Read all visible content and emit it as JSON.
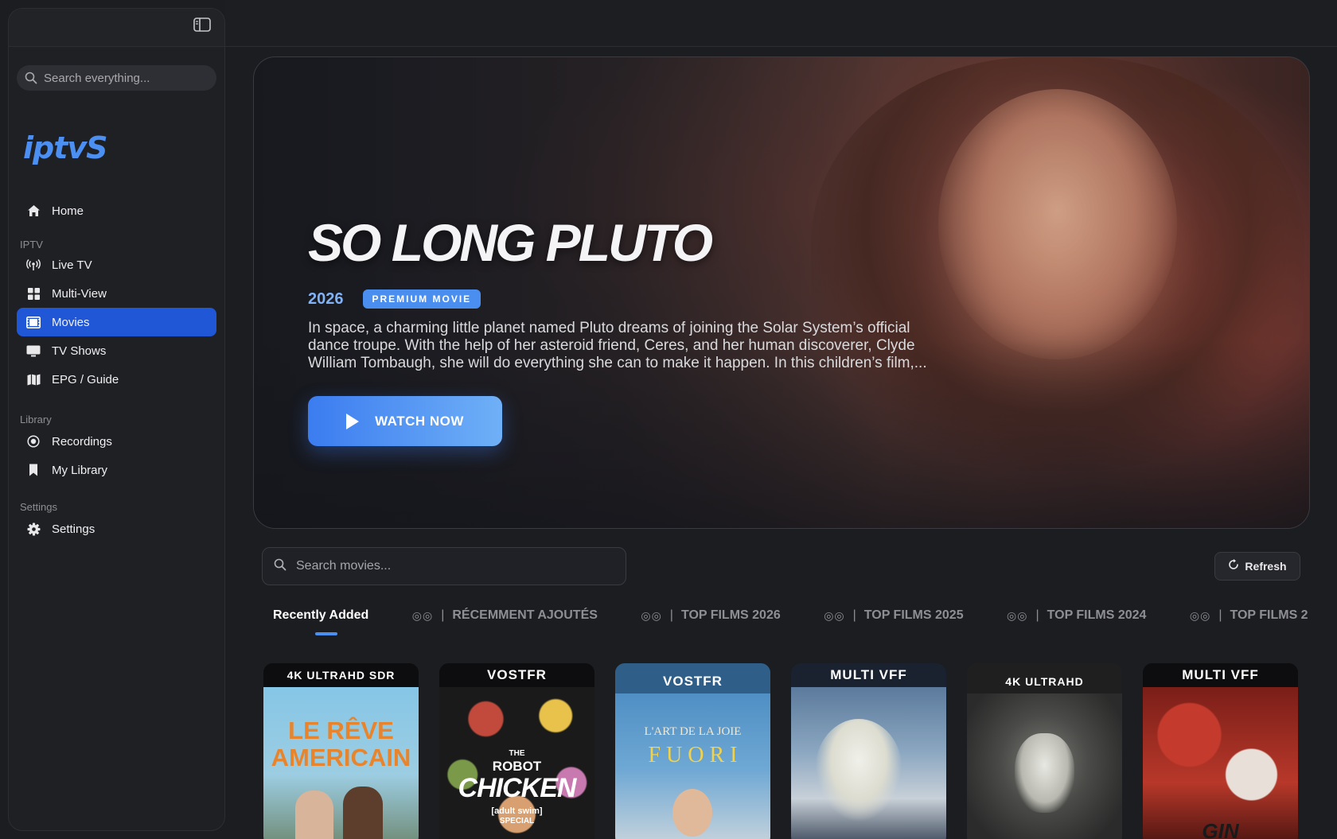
{
  "sidebar": {
    "search_placeholder": "Search everything...",
    "logo": "iptvS",
    "items": [
      {
        "label": "Home"
      },
      {
        "label": "Live TV"
      },
      {
        "label": "Multi-View"
      },
      {
        "label": "Movies"
      },
      {
        "label": "TV Shows"
      },
      {
        "label": "EPG / Guide"
      },
      {
        "label": "Recordings"
      },
      {
        "label": "My Library"
      },
      {
        "label": "Settings"
      }
    ],
    "sections": {
      "iptv": "IPTV",
      "library": "Library",
      "settings": "Settings"
    },
    "active_item": "Movies",
    "accent_color": "#2057d6"
  },
  "hero": {
    "title": "SO LONG PLUTO",
    "year": "2026",
    "badge": "PREMIUM MOVIE",
    "description": "In space, a charming little planet named Pluto dreams of joining the Solar System’s official dance troupe. With the help of her asteroid friend, Ceres, and her human discoverer, Clyde William Tombaugh, she will do everything she can to make it happen. In this children’s film,...",
    "watch_label": "WATCH NOW"
  },
  "movies": {
    "search_placeholder": "Search movies...",
    "refresh_label": "Refresh",
    "tabs": [
      {
        "label": "Recently Added"
      },
      {
        "label": "RÉCEMMENT AJOUTÉS",
        "prefix": "◎◎",
        "sep": "|"
      },
      {
        "label": "TOP FILMS 2026",
        "prefix": "◎◎",
        "sep": "|"
      },
      {
        "label": "TOP FILMS 2025",
        "prefix": "◎◎",
        "sep": "|"
      },
      {
        "label": "TOP FILMS 2024",
        "prefix": "◎◎",
        "sep": "|"
      },
      {
        "label": "TOP FILMS 2",
        "prefix": "◎◎",
        "sep": "|"
      }
    ],
    "posters": [
      {
        "banner": "4K ULTRAHD SDR",
        "art_lines": [
          "LE RÊVE",
          "AMERICAIN"
        ]
      },
      {
        "banner": "VOSTFR",
        "art_lines": [
          "THE",
          "ROBOT",
          "CHICKEN",
          "[adult swim]",
          "SPECIAL"
        ]
      },
      {
        "banner": "VOSTFR",
        "art_lines": [
          "L'ART DE LA JOIE",
          "F U O R I"
        ]
      },
      {
        "banner": "MULTI VFF",
        "art_lines": []
      },
      {
        "banner": "4K ULTRAHD",
        "art_lines": []
      },
      {
        "banner": "MULTI VFF",
        "art_lines": [
          "GIN"
        ]
      }
    ]
  }
}
